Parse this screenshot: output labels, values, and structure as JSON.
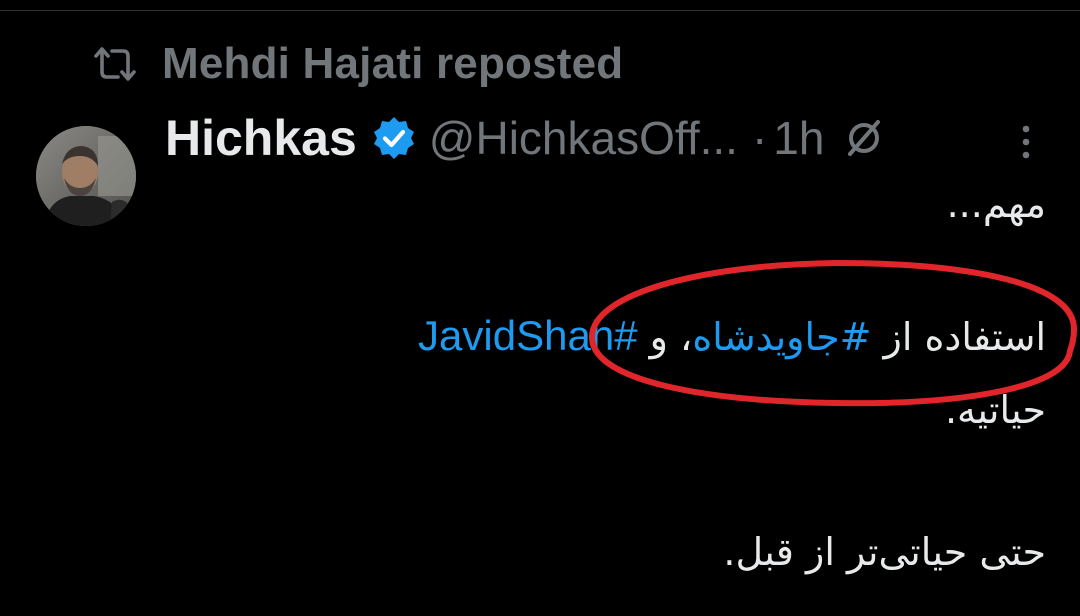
{
  "repost": {
    "icon": "repost-icon",
    "label": "Mehdi Hajati reposted"
  },
  "author": {
    "avatar": "avatar",
    "name": "Hichkas",
    "verified_icon": "verified-badge-icon",
    "handle": "@HichkasOff...",
    "separator": "·",
    "time": "1h",
    "muted_icon": "no-sign-icon"
  },
  "menu": {
    "more_icon": "more-vertical-icon"
  },
  "tweet": {
    "line1": "مهم...",
    "line2_text": "استفاده از ",
    "line2_hashtag_fa": "#جاویدشاه",
    "line2_mid": "، و ",
    "line2_hashtag_en": "#JavidShah",
    "line3": "حیاتیه.",
    "line4": "حتی حیاتی‌تر از قبل."
  },
  "annotation": {
    "shape": "ellipse",
    "color": "#e0262b"
  },
  "colors": {
    "background": "#000000",
    "text": "#e7e9ea",
    "muted": "#71767b",
    "link": "#1d9bf0",
    "verified": "#1d9bf0"
  }
}
